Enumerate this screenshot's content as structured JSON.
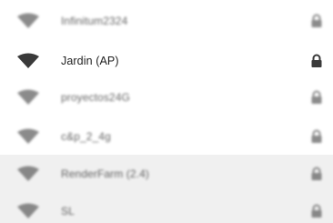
{
  "networks": [
    {
      "ssid": "Infinitum2324",
      "signal_icon": "wifi-signal-icon",
      "secured_icon": "lock-icon",
      "state": "blurred"
    },
    {
      "ssid": "Jardin (AP)",
      "signal_icon": "wifi-signal-icon",
      "secured_icon": "lock-icon",
      "state": "focused"
    },
    {
      "ssid": "proyectos24G",
      "signal_icon": "wifi-signal-icon",
      "secured_icon": "lock-icon",
      "state": "blurred"
    },
    {
      "ssid": "c&p_2_4g",
      "signal_icon": "wifi-signal-icon",
      "secured_icon": "lock-icon",
      "state": "blurred"
    },
    {
      "ssid": "RenderFarm (2.4)",
      "signal_icon": "wifi-signal-icon",
      "secured_icon": "lock-icon",
      "state": "blurred-highlighted"
    },
    {
      "ssid": "SL",
      "signal_icon": "wifi-signal-icon",
      "secured_icon": "lock-icon",
      "state": "blurred"
    }
  ],
  "colors": {
    "icon": "#5f5f5f",
    "icon_focus": "#3a3a3a",
    "text": "#2b2b2b",
    "highlight_row": "#f0f0f0",
    "background": "#ffffff"
  }
}
